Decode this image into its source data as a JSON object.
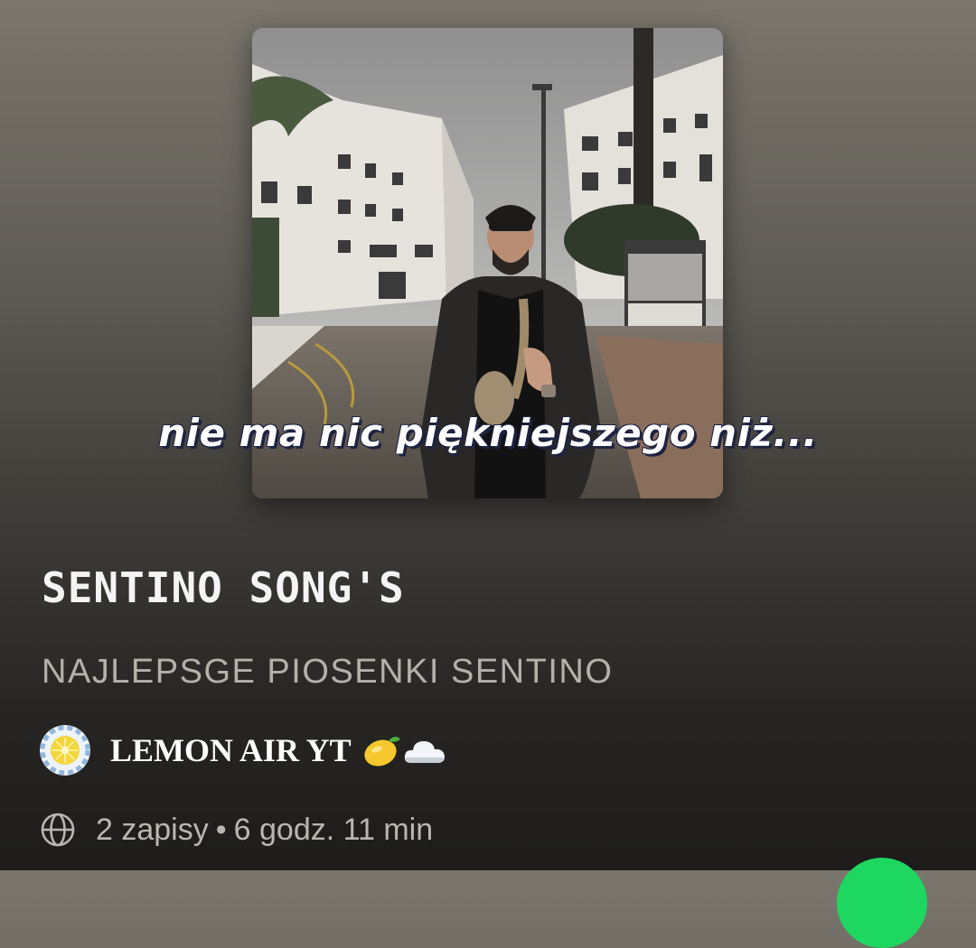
{
  "playlist": {
    "cover_caption": "nie ma nic piękniejszego niż...",
    "title": "SENTINO SONG'S",
    "description": "NAJLEPSGE PIOSENKI SENTINO",
    "owner": {
      "name": "LEMON AIR YT",
      "emoji_icons": [
        "lemon-icon",
        "cloud-icon"
      ]
    },
    "meta": {
      "visibility_icon": "globe-icon",
      "saves": "2 zapisy",
      "separator": "•",
      "duration": "6 godz. 11 min"
    }
  },
  "colors": {
    "accent": "#1ed760",
    "background_top": "#7a766d",
    "background_bottom": "#1d1c1b"
  }
}
